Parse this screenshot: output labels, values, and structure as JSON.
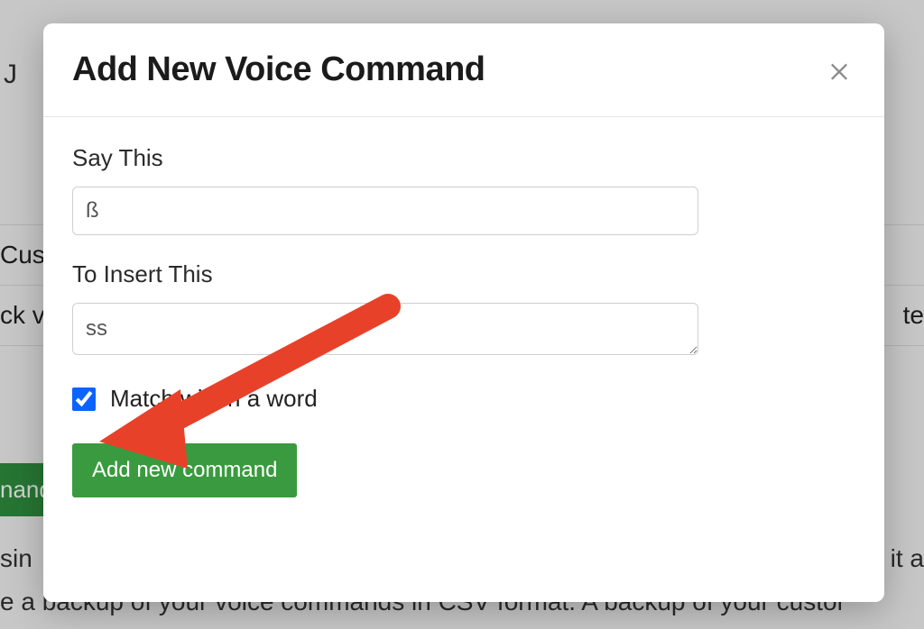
{
  "modal": {
    "title": "Add New Voice Command",
    "close_icon": "close",
    "fields": {
      "say_this_label": "Say This",
      "say_this_value": "ß",
      "to_insert_label": "To Insert This",
      "to_insert_value": "ss",
      "match_within_label": "Match within a word",
      "match_within_checked": true
    },
    "submit_label": "Add new command"
  },
  "background": {
    "frag_top": "J",
    "row_cus": "Cus",
    "row_ck_left": "ck v",
    "row_ck_right": "te",
    "green_button_text": "nand",
    "lower1_left": "sin",
    "lower1_right": "it a",
    "lower2": "e a backup of your voice commands in CSV format. A backup of your custor"
  },
  "annotation": {
    "arrow_color": "#e8412a"
  }
}
